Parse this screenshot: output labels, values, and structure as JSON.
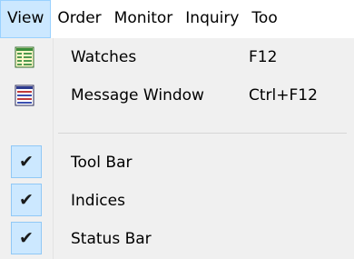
{
  "menubar": {
    "items": [
      {
        "label": "View"
      },
      {
        "label": "Order"
      },
      {
        "label": "Monitor"
      },
      {
        "label": "Inquiry"
      },
      {
        "label": "Too"
      }
    ]
  },
  "dropdown": {
    "watches": {
      "label": "Watches",
      "shortcut": "F12",
      "icon": "watches-grid-icon"
    },
    "message_window": {
      "label": "Message Window",
      "shortcut": "Ctrl+F12",
      "icon": "message-window-icon"
    },
    "tool_bar": {
      "label": "Tool Bar",
      "checked": true,
      "check": "✔"
    },
    "indices": {
      "label": "Indices",
      "checked": true,
      "check": "✔"
    },
    "status_bar": {
      "label": "Status Bar",
      "checked": true,
      "check": "✔"
    }
  }
}
